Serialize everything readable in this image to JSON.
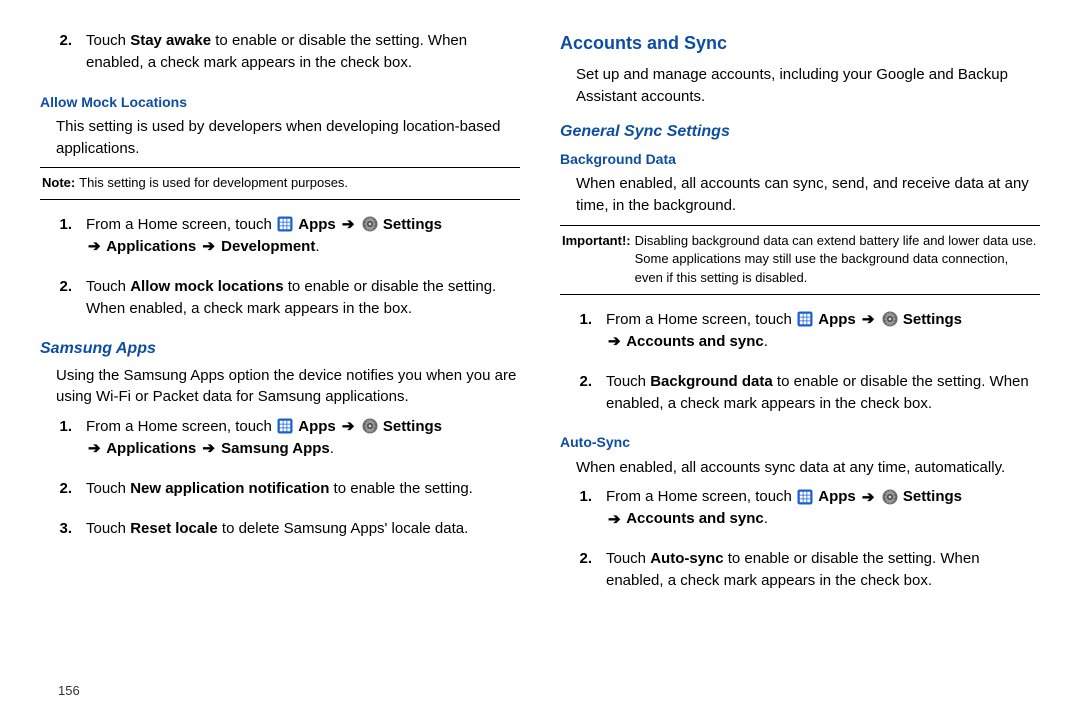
{
  "left": {
    "stayAwake": {
      "num": "2.",
      "pre": "Touch ",
      "bold": "Stay awake",
      "post": " to enable or disable the setting. When enabled, a check mark appears in the check box."
    },
    "mockHeading": "Allow Mock Locations",
    "mockDesc": "This setting is used by developers when developing location-based applications.",
    "noteLabel": "Note:",
    "noteText": "This setting is used for development purposes.",
    "steps1": {
      "s1num": "1.",
      "s1pre": "From a Home screen, touch ",
      "apps": "Apps",
      "settings": "Settings",
      "path": "Applications",
      "path2": "Development",
      "s2num": "2.",
      "s2pre": "Touch ",
      "s2bold": "Allow mock locations",
      "s2post": " to enable or disable the setting. When enabled, a check mark appears in the box."
    },
    "samsungHeading": "Samsung Apps",
    "samsungDesc": "Using the Samsung Apps option the device notifies you when you are using Wi-Fi or Packet data for Samsung applications.",
    "steps2": {
      "s1num": "1.",
      "s1pre": "From a Home screen, touch ",
      "apps": "Apps",
      "settings": "Settings",
      "path": "Applications",
      "path2": "Samsung Apps",
      "s2num": "2.",
      "s2pre": "Touch ",
      "s2bold": "New application notification",
      "s2post": " to enable the setting.",
      "s3num": "3.",
      "s3pre": "Touch ",
      "s3bold": "Reset locale",
      "s3post": " to delete Samsung Apps' locale data."
    }
  },
  "right": {
    "sectionHeading": "Accounts and Sync",
    "sectionDesc": "Set up and manage accounts, including your Google and Backup Assistant accounts.",
    "subHeading": "General Sync Settings",
    "bgHeading": "Background Data",
    "bgDesc": "When enabled, all accounts can sync, send, and receive data at any time, in the background.",
    "impLabel": "Important!:",
    "impText": "Disabling background data can extend battery life and lower data use. Some applications may still use the background data connection, even if this setting is disabled.",
    "steps1": {
      "s1num": "1.",
      "s1pre": "From a Home screen, touch ",
      "apps": "Apps",
      "settings": "Settings",
      "path": "Accounts and sync",
      "s2num": "2.",
      "s2pre": "Touch ",
      "s2bold": "Background data",
      "s2post": " to enable or disable the setting. When enabled, a check mark appears in the check box."
    },
    "autoHeading": "Auto-Sync",
    "autoDesc": "When enabled, all accounts sync data at any time, automatically.",
    "steps2": {
      "s1num": "1.",
      "s1pre": "From a Home screen, touch ",
      "apps": "Apps",
      "settings": "Settings",
      "path": "Accounts and sync",
      "s2num": "2.",
      "s2pre": "Touch ",
      "s2bold": "Auto-sync",
      "s2post": " to enable or disable the setting. When enabled, a check mark appears in the check box."
    }
  },
  "pageNum": "156"
}
